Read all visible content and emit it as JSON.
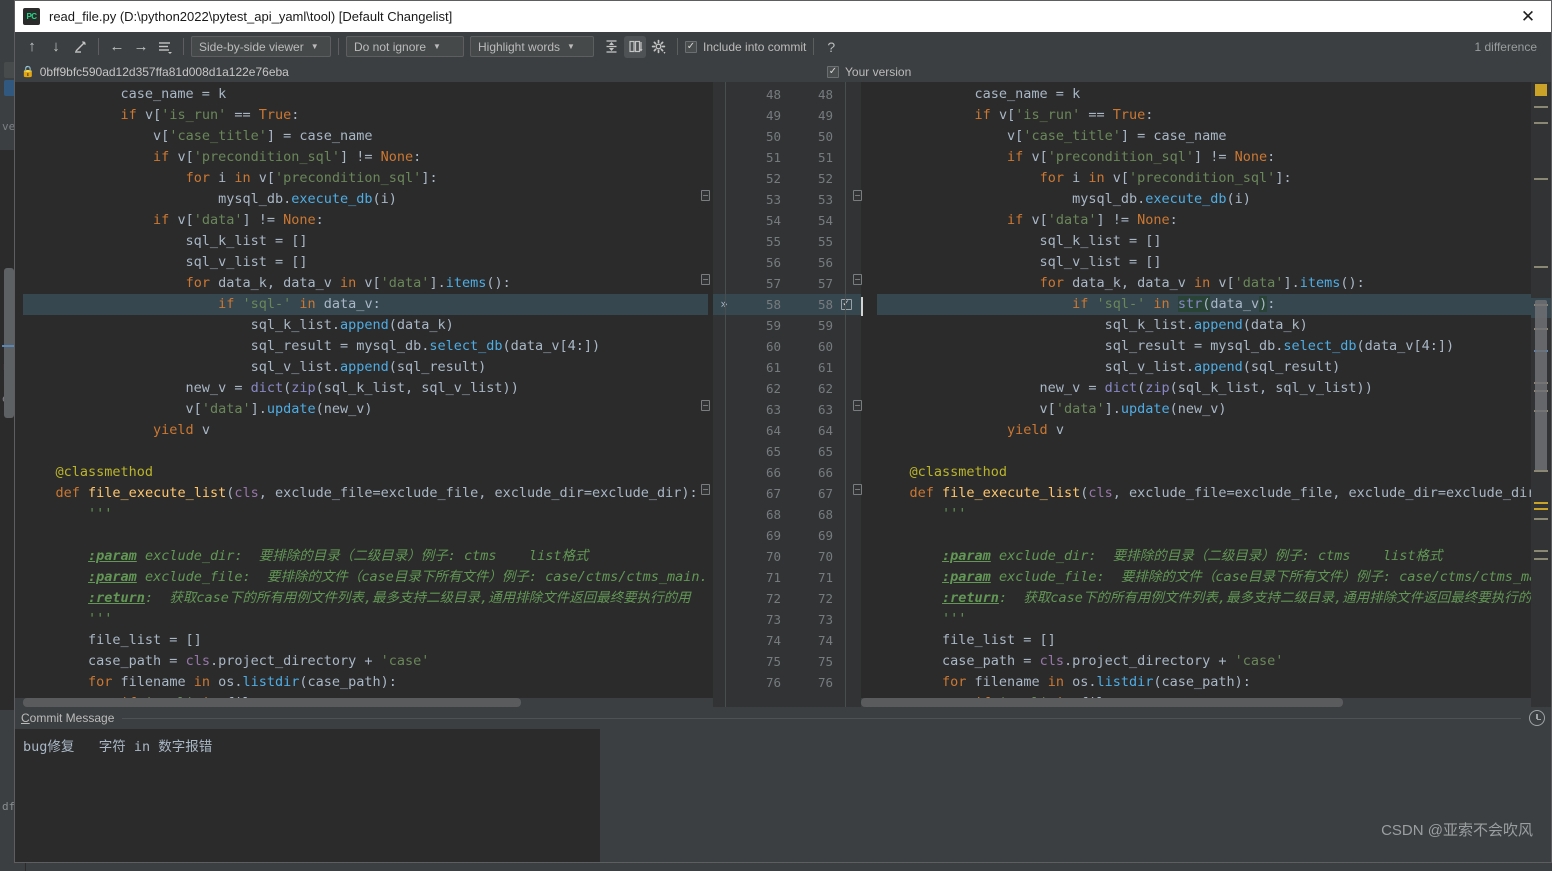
{
  "window": {
    "title": "read_file.py (D:\\python2022\\pytest_api_yaml\\tool) [Default Changelist]",
    "logo_text": "PC",
    "close_icon": "✕"
  },
  "toolbar": {
    "icons": [
      {
        "name": "previous-difference-icon",
        "glyph": "↑"
      },
      {
        "name": "next-difference-icon",
        "glyph": "↓"
      },
      {
        "name": "apply-edit-icon",
        "glyph": "╱"
      },
      {
        "name": "go-back-icon",
        "glyph": "←"
      },
      {
        "name": "go-forward-icon",
        "glyph": "→"
      },
      {
        "name": "lines-menu-icon",
        "glyph": "≡"
      }
    ],
    "viewer_mode": "Side-by-side viewer",
    "ignore_policy": "Do not ignore",
    "highlight_mode": "Highlight words",
    "collapse_icon": "⩴",
    "sync_scroll_icon": "▥",
    "settings_icon": "⚙",
    "include_into_commit": {
      "label": "Include into commit",
      "checked": true,
      "check_glyph": "✓"
    },
    "help_icon": "?",
    "difference_count": "1 difference"
  },
  "revision_bar": {
    "lock_icon": "🔒",
    "left_revision": "0bff9bfc590ad12d357ffa81d008d1a122e76eba",
    "right_label": "Your version",
    "right_checked": true,
    "check_glyph": "✓"
  },
  "gutter": {
    "diff_marker": "»",
    "diff_line_checked": true,
    "check_glyph": "✓",
    "lines": [
      {
        "left": "48",
        "right": "48"
      },
      {
        "left": "49",
        "right": "49"
      },
      {
        "left": "50",
        "right": "50"
      },
      {
        "left": "51",
        "right": "51"
      },
      {
        "left": "52",
        "right": "52"
      },
      {
        "left": "53",
        "right": "53"
      },
      {
        "left": "54",
        "right": "54"
      },
      {
        "left": "55",
        "right": "55"
      },
      {
        "left": "56",
        "right": "56"
      },
      {
        "left": "57",
        "right": "57"
      },
      {
        "left": "58",
        "right": "58"
      },
      {
        "left": "59",
        "right": "59"
      },
      {
        "left": "60",
        "right": "60"
      },
      {
        "left": "61",
        "right": "61"
      },
      {
        "left": "62",
        "right": "62"
      },
      {
        "left": "63",
        "right": "63"
      },
      {
        "left": "64",
        "right": "64"
      },
      {
        "left": "65",
        "right": "65"
      },
      {
        "left": "66",
        "right": "66"
      },
      {
        "left": "67",
        "right": "67"
      },
      {
        "left": "68",
        "right": "68"
      },
      {
        "left": "69",
        "right": "69"
      },
      {
        "left": "70",
        "right": "70"
      },
      {
        "left": "71",
        "right": "71"
      },
      {
        "left": "72",
        "right": "72"
      },
      {
        "left": "73",
        "right": "73"
      },
      {
        "left": "74",
        "right": "74"
      },
      {
        "left": "75",
        "right": "75"
      },
      {
        "left": "76",
        "right": "76"
      }
    ]
  },
  "left_pane": {
    "lines": [
      "            case_name = k",
      "            if v['is_run'] == True:",
      "                v['case_title'] = case_name",
      "                if v['precondition_sql'] != None:",
      "                    for i in v['precondition_sql']:",
      "                        mysql_db.execute_db(i)",
      "                if v['data'] != None:",
      "                    sql_k_list = []",
      "                    sql_v_list = []",
      "                    for data_k, data_v in v['data'].items():",
      "                        if 'sql-' in data_v:",
      "                            sql_k_list.append(data_k)",
      "                            sql_result = mysql_db.select_db(data_v[4:])",
      "                            sql_v_list.append(sql_result)",
      "                    new_v = dict(zip(sql_k_list, sql_v_list))",
      "                    v['data'].update(new_v)",
      "                yield v",
      "",
      "    @classmethod",
      "    def file_execute_list(cls, exclude_file=exclude_file, exclude_dir=exclude_dir):",
      "        '''",
      "",
      "        :param exclude_dir:  要排除的目录（二级目录）例子: ctms    list格式",
      "        :param exclude_file:  要排除的文件（case目录下所有文件）例子: case/ctms/ctms_main.",
      "        :return:  获取case下的所有用例文件列表,最多支持二级目录,通用排除文件返回最终要执行的用",
      "        '''",
      "        file_list = []",
      "        case_path = cls.project_directory + 'case'",
      "        for filename in os.listdir(case_path):",
      "            if 'yaml' in filename:"
    ]
  },
  "right_pane": {
    "lines": [
      "            case_name = k",
      "            if v['is_run'] == True:",
      "                v['case_title'] = case_name",
      "                if v['precondition_sql'] != None:",
      "                    for i in v['precondition_sql']:",
      "                        mysql_db.execute_db(i)",
      "                if v['data'] != None:",
      "                    sql_k_list = []",
      "                    sql_v_list = []",
      "                    for data_k, data_v in v['data'].items():",
      "                        if 'sql-' in str(data_v):",
      "                            sql_k_list.append(data_k)",
      "                            sql_result = mysql_db.select_db(data_v[4:])",
      "                            sql_v_list.append(sql_result)",
      "                    new_v = dict(zip(sql_k_list, sql_v_list))",
      "                    v['data'].update(new_v)",
      "                yield v",
      "",
      "    @classmethod",
      "    def file_execute_list(cls, exclude_file=exclude_file, exclude_dir=exclude_dir):",
      "        '''",
      "",
      "        :param exclude_dir:  要排除的目录（二级目录）例子: ctms    list格式",
      "        :param exclude_file:  要排除的文件（case目录下所有文件）例子: case/ctms/ctms_main.ya",
      "        :return:  获取case下的所有用例文件列表,最多支持二级目录,通用排除文件返回最终要执行的用例",
      "        '''",
      "        file_list = []",
      "        case_path = cls.project_directory + 'case'",
      "        for filename in os.listdir(case_path):",
      "            if 'yaml' in filename:"
    ]
  },
  "commit_panel": {
    "title": "Commit Message",
    "title_mnemonic": "C",
    "message": "bug修复   字符 in 数字报错",
    "history_icon": "clock-icon"
  },
  "watermark": "CSDN @亚索不会吹风",
  "colors": {
    "background": "#2b2b2b",
    "chrome": "#3c3f41",
    "gutter": "#313335",
    "diff_highlight": "#37474f",
    "inserted": "#294436",
    "keyword": "#cc7832",
    "string": "#6a8759",
    "method": "#ffc66d",
    "call": "#4eade5",
    "builtin": "#8888c6",
    "field": "#9876aa",
    "decorator": "#bbb529",
    "docstring": "#629755",
    "text": "#a9b7c6",
    "accent_stripe": "#c9a227"
  }
}
